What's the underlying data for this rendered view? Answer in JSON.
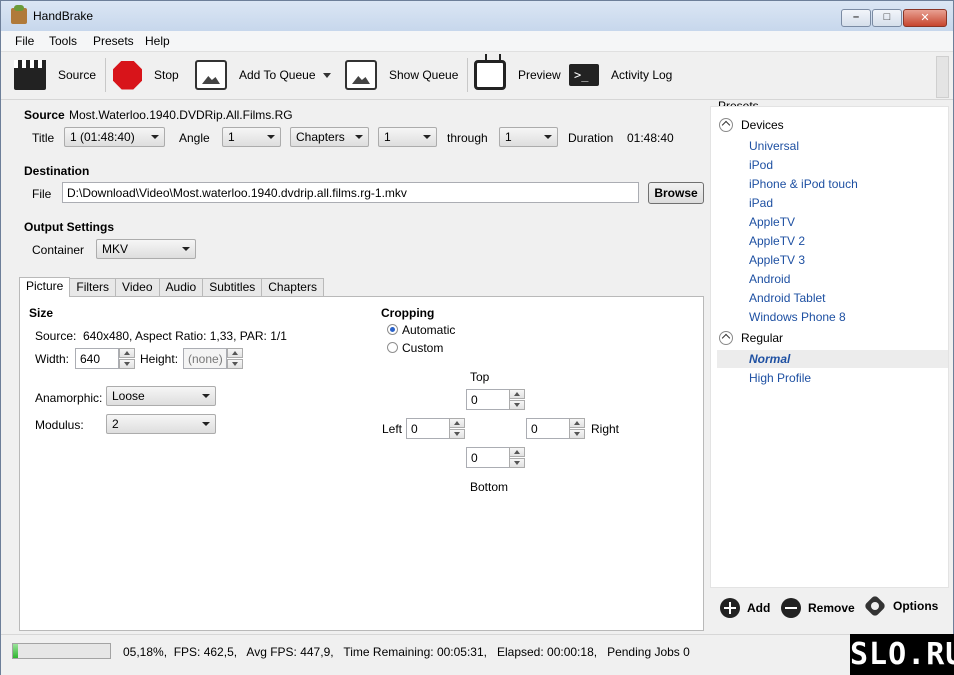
{
  "window": {
    "title": "HandBrake"
  },
  "menu": [
    "File",
    "Tools",
    "Presets",
    "Help"
  ],
  "toolbar": {
    "source": "Source",
    "stop": "Stop",
    "add_to_queue": "Add To Queue",
    "show_queue": "Show Queue",
    "preview": "Preview",
    "activity_log": "Activity Log"
  },
  "source": {
    "label": "Source",
    "value": "Most.Waterloo.1940.DVDRip.All.Films.RG",
    "title_label": "Title",
    "title_value": "1 (01:48:40)",
    "angle_label": "Angle",
    "angle_value": "1",
    "chapters_value": "Chapters",
    "chapter_from": "1",
    "through_label": "through",
    "chapter_to": "1",
    "duration_label": "Duration",
    "duration_value": "01:48:40"
  },
  "destination": {
    "label": "Destination",
    "file_label": "File",
    "file_value": "D:\\Download\\Video\\Most.waterloo.1940.dvdrip.all.films.rg-1.mkv",
    "browse": "Browse"
  },
  "output": {
    "label": "Output Settings",
    "container_label": "Container",
    "container_value": "MKV"
  },
  "tabs": [
    "Picture",
    "Filters",
    "Video",
    "Audio",
    "Subtitles",
    "Chapters"
  ],
  "picture": {
    "size_label": "Size",
    "source_label": "Source:",
    "source_value": "640x480, Aspect Ratio: 1,33, PAR: 1/1",
    "width_label": "Width:",
    "width_value": "640",
    "height_label": "Height:",
    "height_placeholder": "(none)",
    "anamorphic_label": "Anamorphic:",
    "anamorphic_value": "Loose",
    "modulus_label": "Modulus:",
    "modulus_value": "2",
    "cropping_label": "Cropping",
    "automatic": "Automatic",
    "custom": "Custom",
    "top_label": "Top",
    "top_value": "0",
    "left_label": "Left",
    "left_value": "0",
    "right_label": "Right",
    "right_value": "0",
    "bottom_label": "Bottom",
    "bottom_value": "0"
  },
  "presets": {
    "label": "Presets",
    "groups": [
      {
        "name": "Devices",
        "items": [
          "Universal",
          "iPod",
          "iPhone & iPod touch",
          "iPad",
          "AppleTV",
          "AppleTV 2",
          "AppleTV 3",
          "Android",
          "Android Tablet",
          "Windows Phone 8"
        ]
      },
      {
        "name": "Regular",
        "items": [
          "Normal",
          "High Profile"
        ]
      }
    ],
    "selected": "Normal",
    "add": "Add",
    "remove": "Remove",
    "options": "Options"
  },
  "status": {
    "text": "05,18%,  FPS: 462,5,   Avg FPS: 447,9,   Time Remaining: 00:05:31,   Elapsed: 00:00:18,   Pending Jobs 0",
    "progress_percent": 5.18
  },
  "watermark": "SLO.RU"
}
